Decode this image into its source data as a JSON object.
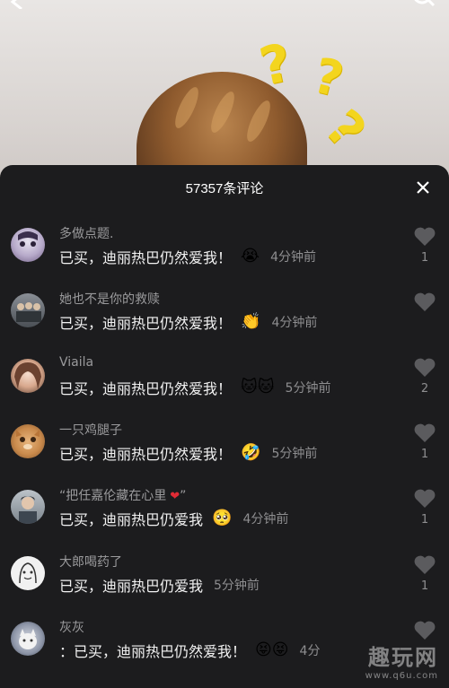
{
  "header": {
    "comment_count_title": "57357条评论"
  },
  "icons": {
    "back": "back-arrow-icon",
    "search": "search-icon",
    "close": "close-icon",
    "like": "heart-icon"
  },
  "video": {
    "overlay_symbols": [
      "?",
      "?",
      "?"
    ]
  },
  "comments": [
    {
      "username": "多做点题.",
      "text": "已买，迪丽热巴仍然爱我！",
      "emoji": "😭",
      "time": "4分钟前",
      "likes": "1"
    },
    {
      "username": "她也不是你的救赎",
      "text": "已买，迪丽热巴仍然爱我！",
      "emoji": "👏",
      "time": "4分钟前",
      "likes": ""
    },
    {
      "username": "Viaila",
      "text": "已买，迪丽热巴仍然爱我！",
      "emoji": "🐱🐱",
      "time": "5分钟前",
      "likes": "2"
    },
    {
      "username": "一只鸡腿子",
      "text": "已买，迪丽热巴仍然爱我！",
      "emoji": "🤣",
      "time": "5分钟前",
      "likes": "1"
    },
    {
      "username": "“把任嘉伦藏在心里",
      "username_suffix": "”",
      "text": "已买，迪丽热巴仍爱我",
      "emoji": "🥺",
      "time": "4分钟前",
      "likes": "1"
    },
    {
      "username": "大郎喝药了",
      "text": "已买，迪丽热巴仍爱我",
      "emoji": "",
      "time": "5分钟前",
      "likes": "1"
    },
    {
      "username": "灰灰",
      "text": "：已买，迪丽热巴仍然爱我！",
      "emoji": "😝😝",
      "time": "4分",
      "likes": ""
    }
  ],
  "watermark": {
    "main": "趣玩网",
    "sub": "www.q6u.com"
  },
  "colors": {
    "panel_bg": "#1c1c1e",
    "username": "#9a9a9c",
    "text": "#f2f2f2",
    "time": "#8e8e90",
    "question_mark": "#f3d51e",
    "heart_inline": "#e02b35"
  }
}
